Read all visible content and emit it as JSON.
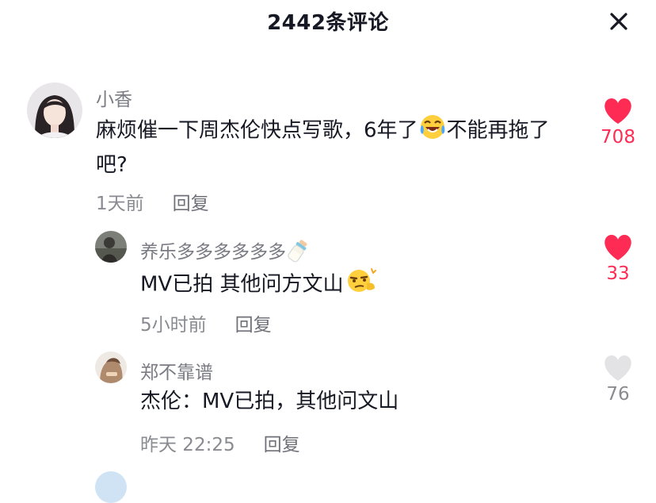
{
  "header": {
    "title": "2442条评论"
  },
  "comments": [
    {
      "user": "小香",
      "text_before": "麻烦催一下周杰伦快点写歌，6年了",
      "text_emoji": "rofl-emoji",
      "text_after": "不能再拖了吧?",
      "time": "1天前",
      "reply": "回复",
      "likes": "708",
      "liked": true
    },
    {
      "user": "养乐多多多多多多",
      "user_emoji": "baby-bottle-emoji",
      "text": "MV已拍 其他问方文山",
      "text_emoji": "sly-face-emoji",
      "time": "5小时前",
      "reply": "回复",
      "likes": "33",
      "liked": true
    },
    {
      "user": "郑不靠谱",
      "text": "杰伦：MV已拍，其他问文山",
      "time": "昨天 22:25",
      "reply": "回复",
      "likes": "76",
      "liked": false
    }
  ],
  "colors": {
    "liked": "#fe2c55",
    "unliked": "#e3e3e5",
    "text": "#161823",
    "muted": "#8a8b91"
  }
}
